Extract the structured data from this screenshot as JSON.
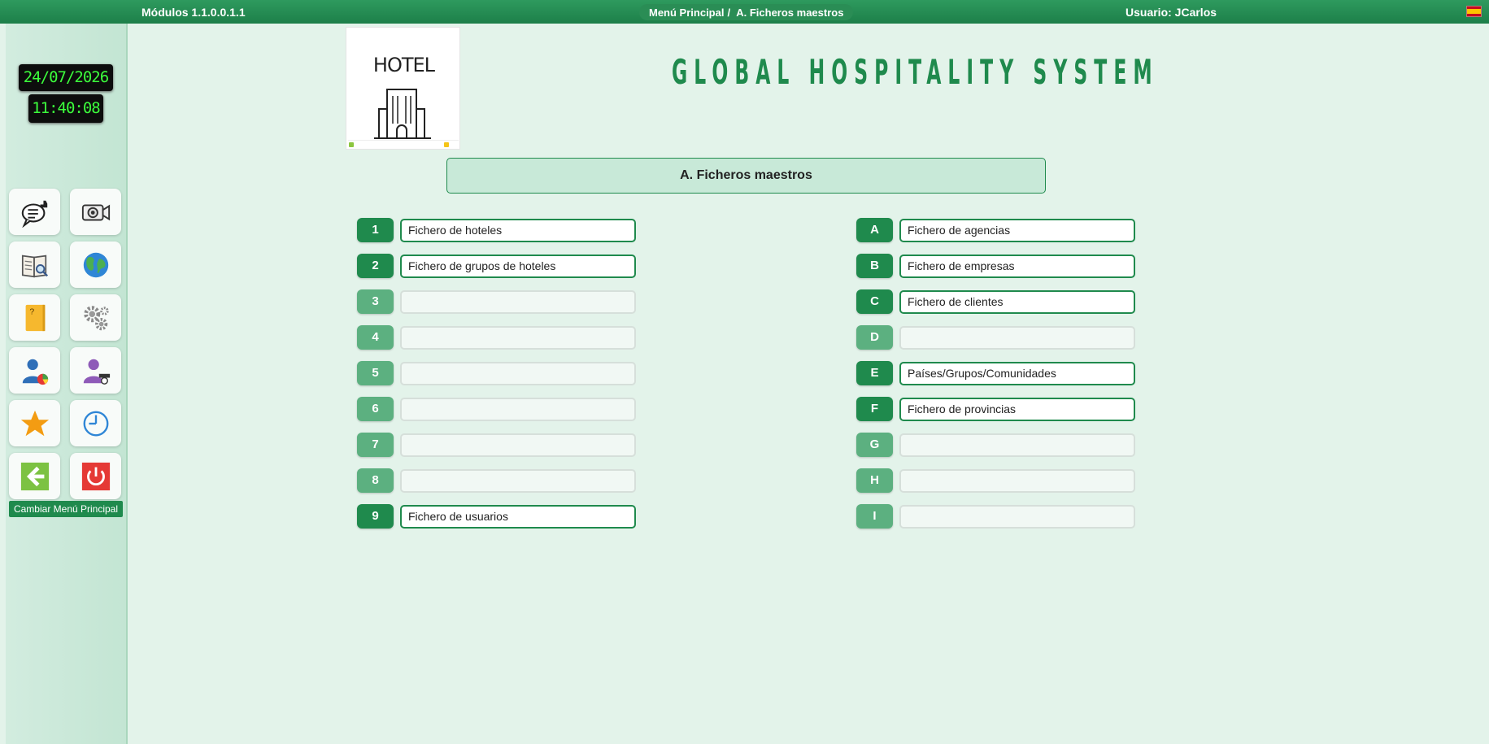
{
  "topbar": {
    "version": "Módulos 1.1.0.0.1.1",
    "breadcrumb_root": "Menú Principal",
    "breadcrumb_sep": "/",
    "breadcrumb_current": "A. Ficheros maestros",
    "user": "Usuario: JCarlos",
    "language_flag": "es-flag-icon"
  },
  "sidebar": {
    "date": "24/07/2026",
    "time": "11:40:08",
    "tiles": [
      {
        "icon": "chat-like-icon"
      },
      {
        "icon": "video-camera-icon"
      },
      {
        "icon": "book-search-icon"
      },
      {
        "icon": "globe-icon"
      },
      {
        "icon": "help-folder-icon"
      },
      {
        "icon": "settings-gears-icon"
      },
      {
        "icon": "user-stats-icon"
      },
      {
        "icon": "user-admin-icon"
      },
      {
        "icon": "favorite-star-icon"
      },
      {
        "icon": "clock-history-icon"
      },
      {
        "icon": "back-arrow-icon"
      },
      {
        "icon": "power-off-icon"
      }
    ],
    "change_menu_label": "Cambiar Menú Principal"
  },
  "header": {
    "logo_text": "HOTEL",
    "title": "GLOBAL HOSPITALITY SYSTEM"
  },
  "section": {
    "title": "A. Ficheros maestros"
  },
  "left_options": [
    {
      "key": "1",
      "label": "Fichero de hoteles",
      "enabled": true
    },
    {
      "key": "2",
      "label": "Fichero de grupos de hoteles",
      "enabled": true
    },
    {
      "key": "3",
      "label": "",
      "enabled": false
    },
    {
      "key": "4",
      "label": "",
      "enabled": false
    },
    {
      "key": "5",
      "label": "",
      "enabled": false
    },
    {
      "key": "6",
      "label": "",
      "enabled": false
    },
    {
      "key": "7",
      "label": "",
      "enabled": false
    },
    {
      "key": "8",
      "label": "",
      "enabled": false
    },
    {
      "key": "9",
      "label": "Fichero de usuarios",
      "enabled": true
    }
  ],
  "right_options": [
    {
      "key": "A",
      "label": "Fichero de agencias",
      "enabled": true
    },
    {
      "key": "B",
      "label": "Fichero de empresas",
      "enabled": true
    },
    {
      "key": "C",
      "label": "Fichero de clientes",
      "enabled": true
    },
    {
      "key": "D",
      "label": "",
      "enabled": false
    },
    {
      "key": "E",
      "label": "Países/Grupos/Comunidades",
      "enabled": true
    },
    {
      "key": "F",
      "label": "Fichero de provincias",
      "enabled": true
    },
    {
      "key": "G",
      "label": "",
      "enabled": false
    },
    {
      "key": "H",
      "label": "",
      "enabled": false
    },
    {
      "key": "I",
      "label": "",
      "enabled": false
    }
  ],
  "colors": {
    "brand_green": "#1f8a4d",
    "disabled_green": "#5cb080",
    "background": "#e3f3ea"
  }
}
